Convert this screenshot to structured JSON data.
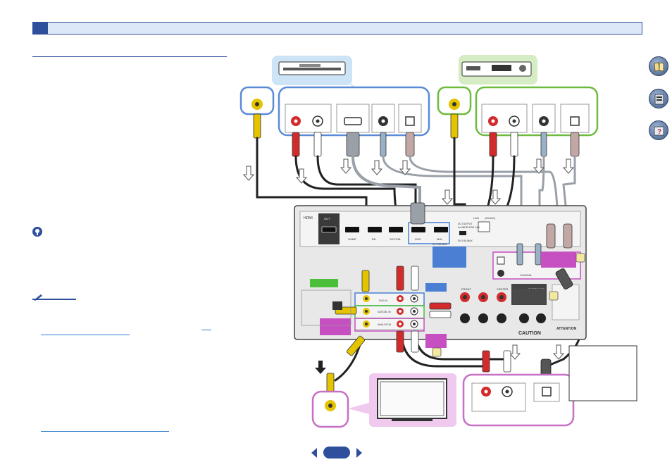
{
  "navigation": {
    "prev_icon": "chevron-left-icon",
    "next_icon": "chevron-right-icon"
  },
  "side_icons": [
    "book-icon",
    "device-icon",
    "help-icon"
  ],
  "receiver": {
    "hdmi_label": "HDMI",
    "out_label": "OUT",
    "inputs": [
      "GAME",
      "BD",
      "SAT/CBL",
      "DVD",
      "MHL"
    ],
    "lan_label": "LAN",
    "lan_sub": "(10/100)",
    "dc_output": "DC OUTPUT",
    "wireless_lan": "for WIRELESS LAN",
    "dc_spec": "5V 0.6A MAX",
    "mhl_spec": "5V 0.9A MAX",
    "dvd_in": "DVD IN",
    "satcbl_in": "SAT/CBL IN",
    "analog_in": "ANALOG IN",
    "front": "FRONT",
    "center": "CENTER",
    "surround": "SURROUND",
    "coaxial": "COAXIAL",
    "caution": "CAUTION",
    "attention": "ATTENTION"
  },
  "colors": {
    "accent": "#2e4f9b",
    "dvd_frame": "#5b8ad6",
    "cd_frame": "#6dbb3f",
    "tv_frame": "#c66fc5",
    "magenta_label": "#c64fc1",
    "blue_label": "#4a7fd4",
    "green_label": "#4bbf3a"
  }
}
